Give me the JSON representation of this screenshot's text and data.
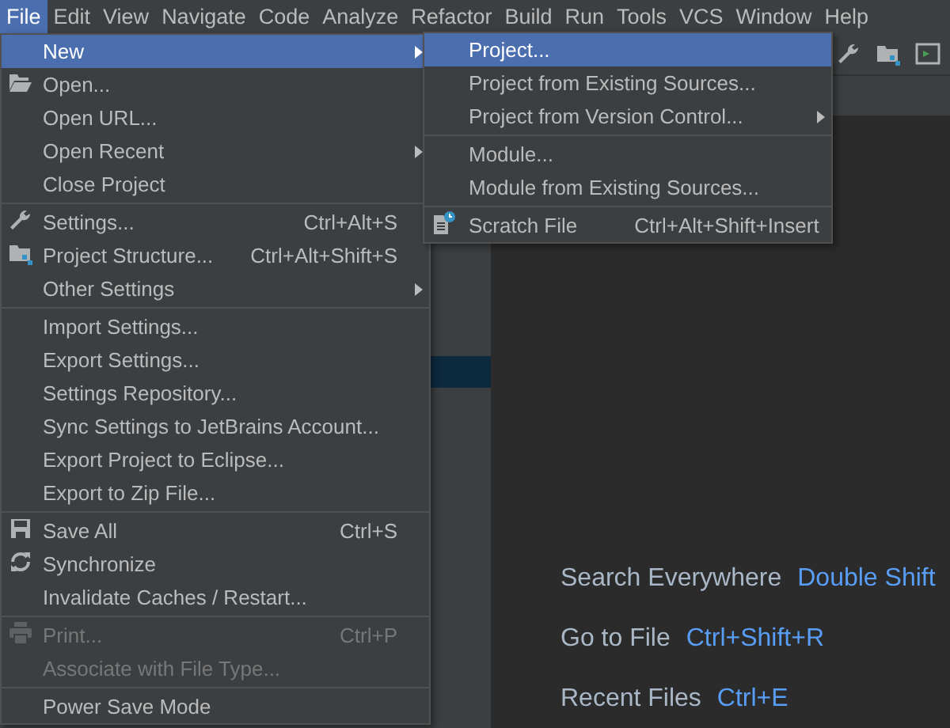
{
  "menubar": [
    {
      "label": "File",
      "selected": true
    },
    {
      "label": "Edit",
      "selected": false
    },
    {
      "label": "View",
      "selected": false
    },
    {
      "label": "Navigate",
      "selected": false
    },
    {
      "label": "Code",
      "selected": false
    },
    {
      "label": "Analyze",
      "selected": false
    },
    {
      "label": "Refactor",
      "selected": false
    },
    {
      "label": "Build",
      "selected": false
    },
    {
      "label": "Run",
      "selected": false
    },
    {
      "label": "Tools",
      "selected": false
    },
    {
      "label": "VCS",
      "selected": false
    },
    {
      "label": "Window",
      "selected": false
    },
    {
      "label": "Help",
      "selected": false
    }
  ],
  "file_menu": {
    "groups": [
      {
        "items": [
          {
            "label": "New",
            "has_submenu": true,
            "selected": true,
            "disabled": false
          },
          {
            "label": "Open...",
            "has_submenu": false,
            "selected": false,
            "disabled": false
          },
          {
            "label": "Open URL...",
            "has_submenu": false,
            "selected": false,
            "disabled": false
          },
          {
            "label": "Open Recent",
            "has_submenu": true,
            "selected": false,
            "disabled": false
          },
          {
            "label": "Close Project",
            "has_submenu": false,
            "selected": false,
            "disabled": false
          }
        ]
      },
      {
        "items": [
          {
            "label": "Settings...",
            "shortcut": "Ctrl+Alt+S",
            "has_submenu": false,
            "selected": false,
            "disabled": false
          },
          {
            "label": "Project Structure...",
            "shortcut": "Ctrl+Alt+Shift+S",
            "has_submenu": false,
            "selected": false,
            "disabled": false
          },
          {
            "label": "Other Settings",
            "has_submenu": true,
            "selected": false,
            "disabled": false
          }
        ]
      },
      {
        "items": [
          {
            "label": "Import Settings...",
            "has_submenu": false,
            "selected": false,
            "disabled": false
          },
          {
            "label": "Export Settings...",
            "has_submenu": false,
            "selected": false,
            "disabled": false
          },
          {
            "label": "Settings Repository...",
            "has_submenu": false,
            "selected": false,
            "disabled": false
          },
          {
            "label": "Sync Settings to JetBrains Account...",
            "has_submenu": false,
            "selected": false,
            "disabled": false
          },
          {
            "label": "Export Project to Eclipse...",
            "has_submenu": false,
            "selected": false,
            "disabled": false
          },
          {
            "label": "Export to Zip File...",
            "has_submenu": false,
            "selected": false,
            "disabled": false
          }
        ]
      },
      {
        "items": [
          {
            "label": "Save All",
            "shortcut": "Ctrl+S",
            "has_submenu": false,
            "selected": false,
            "disabled": false
          },
          {
            "label": "Synchronize",
            "has_submenu": false,
            "selected": false,
            "disabled": false
          },
          {
            "label": "Invalidate Caches / Restart...",
            "has_submenu": false,
            "selected": false,
            "disabled": false
          }
        ]
      },
      {
        "items": [
          {
            "label": "Print...",
            "shortcut": "Ctrl+P",
            "has_submenu": false,
            "selected": false,
            "disabled": true
          },
          {
            "label": "Associate with File Type...",
            "has_submenu": false,
            "selected": false,
            "disabled": true
          }
        ]
      },
      {
        "items": [
          {
            "label": "Power Save Mode",
            "has_submenu": false,
            "selected": false,
            "disabled": false
          }
        ]
      }
    ]
  },
  "new_submenu": {
    "groups": [
      {
        "items": [
          {
            "label": "Project...",
            "has_submenu": false,
            "selected": true,
            "disabled": false
          },
          {
            "label": "Project from Existing Sources...",
            "has_submenu": false,
            "selected": false,
            "disabled": false
          },
          {
            "label": "Project from Version Control...",
            "has_submenu": true,
            "selected": false,
            "disabled": false
          }
        ]
      },
      {
        "items": [
          {
            "label": "Module...",
            "has_submenu": false,
            "selected": false,
            "disabled": false
          },
          {
            "label": "Module from Existing Sources...",
            "has_submenu": false,
            "selected": false,
            "disabled": false
          }
        ]
      },
      {
        "items": [
          {
            "label": "Scratch File",
            "shortcut": "Ctrl+Alt+Shift+Insert",
            "has_submenu": false,
            "selected": false,
            "disabled": false
          }
        ]
      }
    ]
  },
  "welcome_hints": [
    {
      "label": "Search Everywhere",
      "shortcut": "Double Shift"
    },
    {
      "label": "Go to File",
      "shortcut": "Ctrl+Shift+R"
    },
    {
      "label": "Recent Files",
      "shortcut": "Ctrl+E"
    }
  ]
}
